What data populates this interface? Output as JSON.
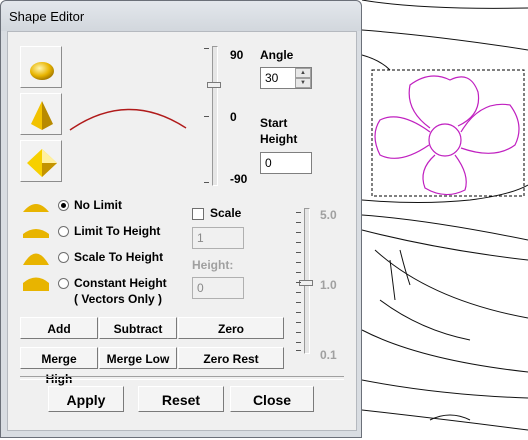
{
  "window": {
    "title": "Shape Editor"
  },
  "shape_buttons": [
    {
      "name": "round-dome-shape-icon"
    },
    {
      "name": "cone-shape-icon"
    },
    {
      "name": "pyramid-shape-icon"
    }
  ],
  "angle_slider": {
    "max_label": "90",
    "mid_label": "0",
    "min_label": "-90",
    "value": 30
  },
  "angle": {
    "label": "Angle",
    "value": "30"
  },
  "start_height": {
    "label_line1": "Start",
    "label_line2": "Height",
    "value": "0"
  },
  "options": [
    {
      "label": "No Limit",
      "checked": true
    },
    {
      "label": "Limit To Height",
      "checked": false
    },
    {
      "label": "Scale To Height",
      "checked": false
    },
    {
      "label": "Constant Height",
      "label2": "( Vectors Only )",
      "checked": false
    }
  ],
  "scale": {
    "label": "Scale",
    "checked": false,
    "value": "1"
  },
  "height": {
    "label": "Height:",
    "value": "0"
  },
  "scale_slider": {
    "max_label": "5.0",
    "mid_label": "1.0",
    "min_label": "0.1",
    "value": 1.0
  },
  "buttons": {
    "add": "Add",
    "subtract": "Subtract",
    "zero": "Zero",
    "merge_high": "Merge High",
    "merge_low": "Merge Low",
    "zero_rest": "Zero Rest",
    "apply": "Apply",
    "reset": "Reset",
    "close": "Close"
  },
  "colors": {
    "preview_curve": "#b01a1a",
    "selection_shape": "#c020c0",
    "dome_gold": "#e8b400"
  }
}
